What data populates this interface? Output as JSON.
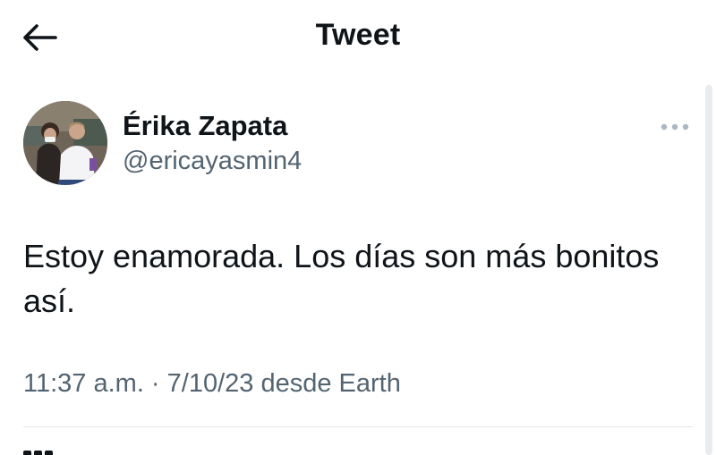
{
  "header": {
    "title": "Tweet",
    "back_icon": "arrow-left-icon"
  },
  "tweet": {
    "author": {
      "display_name": "Érika Zapata",
      "handle": "@ericayasmin4",
      "avatar": "avatar-photo"
    },
    "more_icon": "more-horizontal-icon",
    "text": "Estoy enamorada. Los días son más bonitos así.",
    "meta": "11:37 a.m. · 7/10/23 desde Earth"
  },
  "colors": {
    "text_primary": "#0f1419",
    "text_secondary": "#536471",
    "divider": "#dfe4e8",
    "more_dots": "#aab8c2"
  }
}
